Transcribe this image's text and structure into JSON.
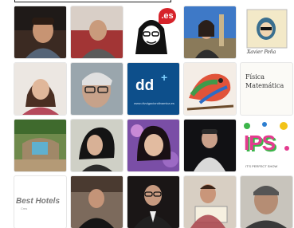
{
  "colors": {
    "brand_red": "#d6232a",
    "dd_blue": "#0d4f8b",
    "ips_pink": "#e43b8f",
    "ips_green": "#3cb54a"
  },
  "tiles": [
    {
      "kind": "photo",
      "alt": "profile-photo"
    },
    {
      "kind": "photo",
      "alt": "profile-photo"
    },
    {
      "kind": "logo",
      "badge": ".es"
    },
    {
      "kind": "photo",
      "alt": "profile-photo"
    },
    {
      "kind": "logo",
      "signature": "Xavier Peña"
    },
    {
      "kind": "photo",
      "alt": "profile-photo"
    },
    {
      "kind": "photo",
      "alt": "profile-photo"
    },
    {
      "kind": "logo",
      "text": "dd",
      "plus": "+",
      "sub": "www.divulgaciondinamica.es"
    },
    {
      "kind": "photo",
      "alt": "profile-photo"
    },
    {
      "kind": "logo",
      "text": "Física Matemática"
    },
    {
      "kind": "photo",
      "alt": "profile-photo"
    },
    {
      "kind": "photo",
      "alt": "profile-photo"
    },
    {
      "kind": "photo",
      "alt": "profile-photo"
    },
    {
      "kind": "photo",
      "alt": "profile-photo"
    },
    {
      "kind": "logo",
      "text": "IPS",
      "sub": "IT'S PERFECT SHOW"
    },
    {
      "kind": "logo",
      "text": "Best Hotels",
      "sub": "Cms"
    },
    {
      "kind": "photo",
      "alt": "profile-photo"
    },
    {
      "kind": "photo",
      "alt": "profile-photo"
    },
    {
      "kind": "photo",
      "alt": "profile-photo"
    },
    {
      "kind": "photo",
      "alt": "profile-photo"
    }
  ]
}
